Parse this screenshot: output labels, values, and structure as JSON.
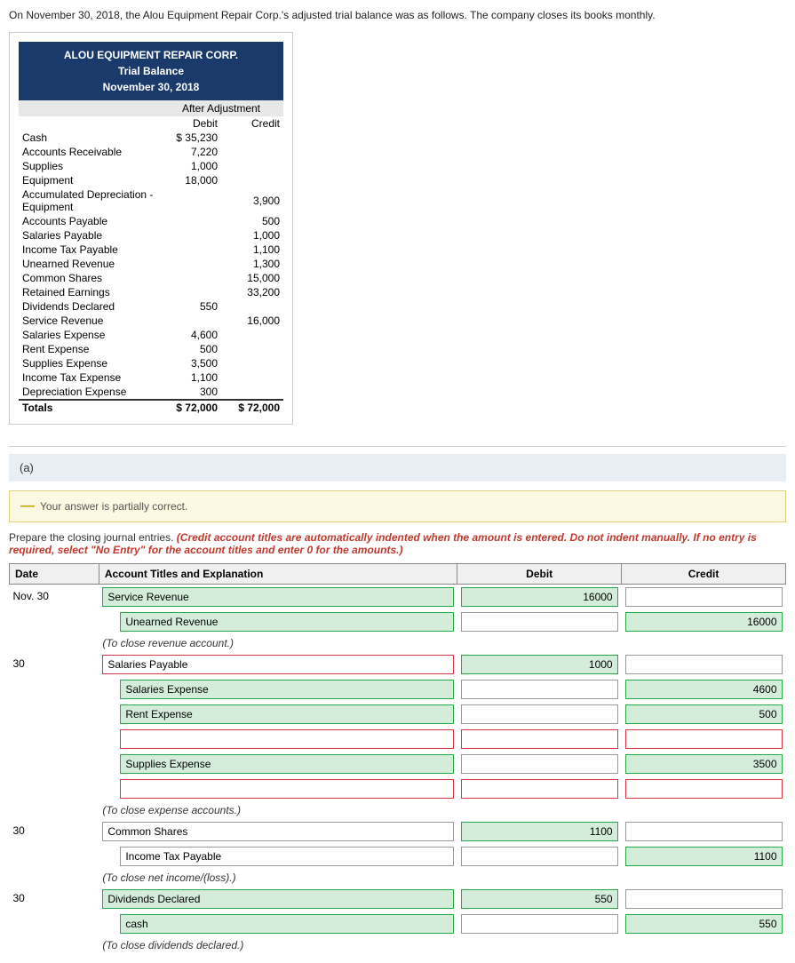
{
  "intro": {
    "text": "On November 30, 2018, the Alou Equipment Repair Corp.'s adjusted trial balance was as follows. The company closes its books monthly."
  },
  "trialBalance": {
    "company": "ALOU EQUIPMENT REPAIR CORP.",
    "title": "Trial Balance",
    "date": "November 30, 2018",
    "subheader": "After Adjustment",
    "col_debit": "Debit",
    "col_credit": "Credit",
    "rows": [
      {
        "account": "Cash",
        "debit": "$ 35,230",
        "credit": ""
      },
      {
        "account": "Accounts Receivable",
        "debit": "7,220",
        "credit": ""
      },
      {
        "account": "Supplies",
        "debit": "1,000",
        "credit": ""
      },
      {
        "account": "Equipment",
        "debit": "18,000",
        "credit": ""
      },
      {
        "account": "Accumulated Depreciation - Equipment",
        "debit": "",
        "credit": "3,900"
      },
      {
        "account": "Accounts Payable",
        "debit": "",
        "credit": "500"
      },
      {
        "account": "Salaries Payable",
        "debit": "",
        "credit": "1,000"
      },
      {
        "account": "Income Tax Payable",
        "debit": "",
        "credit": "1,100"
      },
      {
        "account": "Unearned Revenue",
        "debit": "",
        "credit": "1,300"
      },
      {
        "account": "Common Shares",
        "debit": "",
        "credit": "15,000"
      },
      {
        "account": "Retained Earnings",
        "debit": "",
        "credit": "33,200"
      },
      {
        "account": "Dividends Declared",
        "debit": "550",
        "credit": ""
      },
      {
        "account": "Service Revenue",
        "debit": "",
        "credit": "16,000"
      },
      {
        "account": "Salaries Expense",
        "debit": "4,600",
        "credit": ""
      },
      {
        "account": "Rent Expense",
        "debit": "500",
        "credit": ""
      },
      {
        "account": "Supplies Expense",
        "debit": "3,500",
        "credit": ""
      },
      {
        "account": "Income Tax Expense",
        "debit": "1,100",
        "credit": ""
      },
      {
        "account": "Depreciation Expense",
        "debit": "300",
        "credit": ""
      },
      {
        "account": "Totals",
        "debit": "$ 72,000",
        "credit": "$ 72,000"
      }
    ]
  },
  "sectionA": {
    "label": "(a)"
  },
  "partialCorrect": {
    "text": "Your answer is partially correct."
  },
  "instructions": {
    "main": "Prepare the closing journal entries.",
    "detail": "(Credit account titles are automatically indented when the amount is entered. Do not indent manually. If no entry is required, select \"No Entry\" for the account titles and enter 0 for the amounts.)"
  },
  "journalTable": {
    "headers": [
      "Date",
      "Account Titles and Explanation",
      "Debit",
      "Credit"
    ],
    "entries": [
      {
        "date": "Nov. 30",
        "rows": [
          {
            "type": "main",
            "account": "Service Revenue",
            "debit": "16000",
            "credit": "",
            "acct_style": "green-bg",
            "debit_style": "green-bg",
            "credit_style": "plain"
          },
          {
            "type": "indent",
            "account": "Unearned Revenue",
            "debit": "",
            "credit": "16000",
            "acct_style": "green-bg",
            "debit_style": "plain",
            "credit_style": "green-bg"
          },
          {
            "type": "note",
            "text": "(To close revenue account.)"
          }
        ]
      },
      {
        "date": "30",
        "rows": [
          {
            "type": "main",
            "account": "Salaries Payable",
            "debit": "1000",
            "credit": "",
            "acct_style": "red-border",
            "debit_style": "green-bg",
            "credit_style": "plain"
          },
          {
            "type": "indent",
            "account": "Salaries Expense",
            "debit": "",
            "credit": "4600",
            "acct_style": "green-bg",
            "debit_style": "plain",
            "credit_style": "green-bg"
          },
          {
            "type": "indent",
            "account": "Rent Expense",
            "debit": "",
            "credit": "500",
            "acct_style": "green-bg",
            "debit_style": "plain",
            "credit_style": "green-bg"
          },
          {
            "type": "indent",
            "account": "",
            "debit": "",
            "credit": "",
            "acct_style": "red-border",
            "debit_style": "red-border",
            "credit_style": "red-border"
          },
          {
            "type": "indent",
            "account": "Supplies Expense",
            "debit": "",
            "credit": "3500",
            "acct_style": "green-bg",
            "debit_style": "plain",
            "credit_style": "green-bg"
          },
          {
            "type": "indent",
            "account": "",
            "debit": "",
            "credit": "",
            "acct_style": "red-border",
            "debit_style": "red-border",
            "credit_style": "red-border"
          },
          {
            "type": "note",
            "text": "(To close expense accounts.)"
          }
        ]
      },
      {
        "date": "30",
        "rows": [
          {
            "type": "main",
            "account": "Common Shares",
            "debit": "1100",
            "credit": "",
            "acct_style": "plain",
            "debit_style": "green-bg",
            "credit_style": "plain"
          },
          {
            "type": "indent",
            "account": "Income Tax Payable",
            "debit": "",
            "credit": "1100",
            "acct_style": "plain",
            "debit_style": "plain",
            "credit_style": "green-bg"
          },
          {
            "type": "note",
            "text": "(To close net income/(loss).)"
          }
        ]
      },
      {
        "date": "30",
        "rows": [
          {
            "type": "main",
            "account": "Dividends Declared",
            "debit": "550",
            "credit": "",
            "acct_style": "green-bg",
            "debit_style": "green-bg",
            "credit_style": "plain"
          },
          {
            "type": "indent",
            "account": "cash",
            "debit": "",
            "credit": "550",
            "acct_style": "green-bg",
            "debit_style": "plain",
            "credit_style": "green-bg"
          },
          {
            "type": "note",
            "text": "(To close dividends declared.)"
          }
        ]
      }
    ]
  }
}
